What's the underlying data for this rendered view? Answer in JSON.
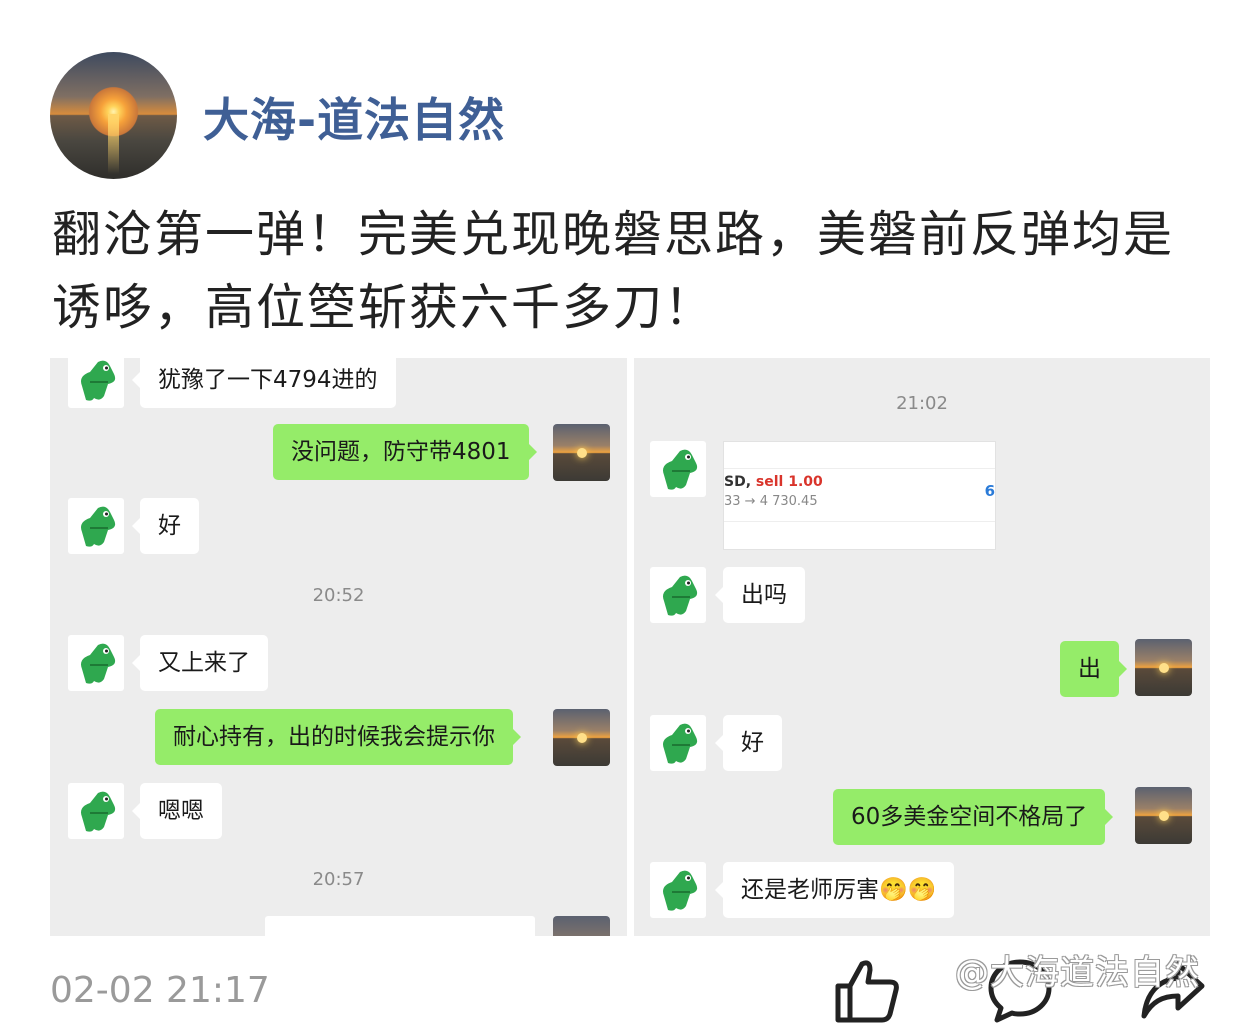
{
  "post": {
    "author": "大海-道法自然",
    "text": "翻沧第一弹！完美兑现晚磐思路，美磐前反弹均是诱哆，高位箜斩获六千多刀！",
    "timestamp": "02-02 21:17",
    "watermark": "@大海道法自然"
  },
  "left_chat": {
    "msg1": "犹豫了一下4794进的",
    "msg2": "没问题，防守带4801",
    "msg3": "好",
    "time1": "20:52",
    "msg4": "又上来了",
    "msg5": "耐心持有，出的时候我会提示你",
    "msg6": "嗯嗯",
    "time2": "20:57"
  },
  "right_chat": {
    "time1": "21:02",
    "card_line1_prefix": "SD,",
    "card_sell": "sell 1.00",
    "card_line2": "33 → 4 730.45",
    "card_num": "6",
    "msg1": "出吗",
    "msg2": "出",
    "msg3": "好",
    "msg4": "60多美金空间不格局了",
    "msg5": "还是老师厉害🤭🤭"
  },
  "icons": {
    "avatar": "sunset-avatar",
    "like": "thumbs-up-icon",
    "comment": "comment-icon",
    "share": "share-icon",
    "contact": "crocodile-avatar"
  },
  "colors": {
    "username": "#3f5f95",
    "bubble_green": "#95ec69",
    "chat_bg": "#ededed"
  }
}
